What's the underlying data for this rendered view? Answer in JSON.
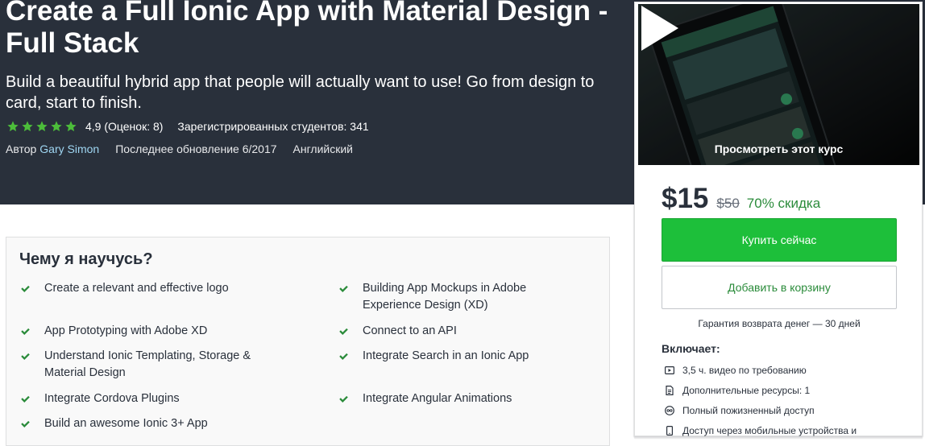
{
  "course": {
    "title": "Create a Full Ionic App with Material Design - Full Stack",
    "subtitle": "Build a beautiful hybrid app that people will actually want to use! Go from design to card, start to finish.",
    "rating_text": "4,9 (Оценок: 8)",
    "students_text": "Зарегистрированных студентов: 341",
    "author_prefix": "Автор",
    "author_name": "Gary Simon",
    "updated_text": "Последнее обновление 6/2017",
    "language": "Английский",
    "stars": 5
  },
  "sidebar": {
    "preview_label": "Просмотреть этот курс",
    "price": "$15",
    "old_price": "$50",
    "discount": "70% скидка",
    "buy_label": "Купить сейчас",
    "cart_label": "Добавить в корзину",
    "guarantee": "Гарантия возврата денег — 30 дней",
    "includes_title": "Включает:",
    "includes": [
      {
        "icon": "video-icon",
        "label": "3,5 ч. видео по требованию"
      },
      {
        "icon": "document-icon",
        "label": "Дополнительные ресурсы: 1"
      },
      {
        "icon": "infinity-icon",
        "label": "Полный пожизненный доступ"
      },
      {
        "icon": "mobile-icon",
        "label": "Доступ через мобильные устройства и"
      }
    ]
  },
  "learn": {
    "title": "Чему я научусь?",
    "items": [
      "Create a relevant and effective logo",
      "Building App Mockups in Adobe Experience Design (XD)",
      "App Prototyping with Adobe XD",
      "Connect to an API",
      "Understand Ionic Templating, Storage & Material Design",
      "Integrate Search in an Ionic App",
      "Integrate Cordova Plugins",
      "Integrate Angular Animations",
      "Build an awesome Ionic 3+ App"
    ]
  },
  "colors": {
    "hero_bg": "#29303b",
    "buy_green": "#1dbf3a",
    "accent_green": "#2a8b3a",
    "star_color": "#4cbd3a",
    "author_link": "#9fd6f2"
  }
}
